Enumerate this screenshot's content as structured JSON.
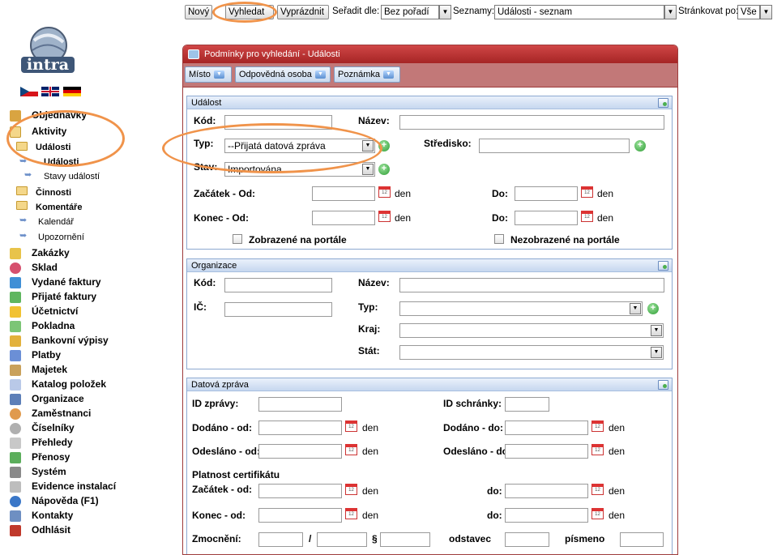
{
  "toolbar": {
    "new_label": "Nový",
    "search_label": "Vyhledat",
    "clear_label": "Vyprázdnit",
    "sort_label": "Seřadit dle:",
    "sort_value": "Bez pořadí",
    "lists_label": "Seznamy:",
    "lists_value": "Události - seznam",
    "paging_label": "Stránkovat po:",
    "paging_value": "Vše"
  },
  "logo": {
    "text": "intra"
  },
  "sidebar": {
    "items": [
      {
        "label": "Objednávky",
        "icon": "orders-icon",
        "color": "#d9a441"
      },
      {
        "label": "Aktivity",
        "icon": "activities-icon",
        "color": "#f4d78a"
      },
      {
        "label": "Zakázky",
        "icon": "contracts-icon",
        "color": "#e8c34a"
      },
      {
        "label": "Sklad",
        "icon": "warehouse-icon",
        "color": "#d6506e"
      },
      {
        "label": "Vydané faktury",
        "icon": "issued-invoices-icon",
        "color": "#3f8fd6"
      },
      {
        "label": "Přijaté faktury",
        "icon": "received-invoices-icon",
        "color": "#5fb65f"
      },
      {
        "label": "Účetnictví",
        "icon": "accounting-icon",
        "color": "#f1c232"
      },
      {
        "label": "Pokladna",
        "icon": "cash-icon",
        "color": "#7cc576"
      },
      {
        "label": "Bankovní výpisy",
        "icon": "bank-statements-icon",
        "color": "#e2b13c"
      },
      {
        "label": "Platby",
        "icon": "payments-icon",
        "color": "#6b8fd6"
      },
      {
        "label": "Majetek",
        "icon": "property-icon",
        "color": "#c9a15b"
      },
      {
        "label": "Katalog položek",
        "icon": "catalog-icon",
        "color": "#b9c9e8"
      },
      {
        "label": "Organizace",
        "icon": "organizations-icon",
        "color": "#5d7fb8"
      },
      {
        "label": "Zaměstnanci",
        "icon": "employees-icon",
        "color": "#e09a4e"
      },
      {
        "label": "Číselníky",
        "icon": "codelists-icon",
        "color": "#b0b0b0"
      },
      {
        "label": "Přehledy",
        "icon": "overviews-icon",
        "color": "#c8c8c8"
      },
      {
        "label": "Přenosy",
        "icon": "transfers-icon",
        "color": "#5cae5c"
      },
      {
        "label": "Systém",
        "icon": "system-icon",
        "color": "#8a8a8a"
      },
      {
        "label": "Evidence instalací",
        "icon": "installations-icon",
        "color": "#bdbdbd"
      },
      {
        "label": "Nápověda (F1)",
        "icon": "help-icon",
        "color": "#3a77c8"
      },
      {
        "label": "Kontakty",
        "icon": "contacts-icon",
        "color": "#6e8fc2"
      },
      {
        "label": "Odhlásit",
        "icon": "logout-icon",
        "color": "#c0392b"
      }
    ],
    "sub_events": "Události",
    "sub_events_child": "Události",
    "sub_event_states": "Stavy událostí",
    "sub_tasks": "Činnosti",
    "sub_comments": "Komentáře",
    "sub_calendar": "Kalendář",
    "sub_notifications": "Upozornění"
  },
  "panel": {
    "title": "Podmínky pro vyhledání - Události",
    "tabs": [
      "Místo",
      "Odpovědná osoba",
      "Poznámka"
    ]
  },
  "event_section": {
    "header": "Událost",
    "code_label": "Kód:",
    "name_label": "Název:",
    "type_label": "Typ:",
    "type_value": "--Přijatá datová zpráva",
    "center_label": "Středisko:",
    "state_label": "Stav:",
    "state_value": "Importována",
    "start_from_label": "Začátek - Od:",
    "end_from_label": "Konec - Od:",
    "to_label": "Do:",
    "den": "den",
    "shown_portal": "Zobrazené na portále",
    "hidden_portal": "Nezobrazené na portále"
  },
  "org_section": {
    "header": "Organizace",
    "code_label": "Kód:",
    "name_label": "Název:",
    "ic_label": "IČ:",
    "type_label": "Typ:",
    "region_label": "Kraj:",
    "state_label": "Stát:"
  },
  "dm_section": {
    "header": "Datová zpráva",
    "msg_id_label": "ID zprávy:",
    "box_id_label": "ID schránky:",
    "delivered_from_label": "Dodáno - od:",
    "delivered_to_label": "Dodáno - do:",
    "sent_from_label": "Odesláno - od:",
    "sent_to_label": "Odesláno - do:",
    "cert_label": "Platnost certifikátu",
    "start_from_label": "Začátek - od:",
    "end_from_label": "Konec - od:",
    "to_label": "do:",
    "den": "den",
    "authorization_label": "Zmocnění:",
    "slash": "/",
    "paragraph": "§",
    "subsection_label": "odstavec",
    "letter_label": "písmeno"
  },
  "colors": {
    "highlight": "#f0934a",
    "panel_header": "#b83232",
    "section_border": "#8da9d1"
  }
}
